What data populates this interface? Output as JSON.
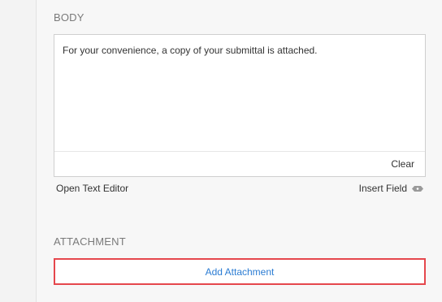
{
  "body_section": {
    "label": "BODY",
    "content": "For your convenience, a copy of your submittal is attached.",
    "clear_label": "Clear",
    "open_editor_label": "Open Text Editor",
    "insert_field_label": "Insert Field",
    "insert_field_icon": "tag-icon"
  },
  "attachment_section": {
    "label": "ATTACHMENT",
    "add_button_label": "Add Attachment"
  },
  "colors": {
    "link": "#2b7cd3",
    "highlight_border": "#e5474d",
    "panel_bg": "#f7f7f7"
  }
}
